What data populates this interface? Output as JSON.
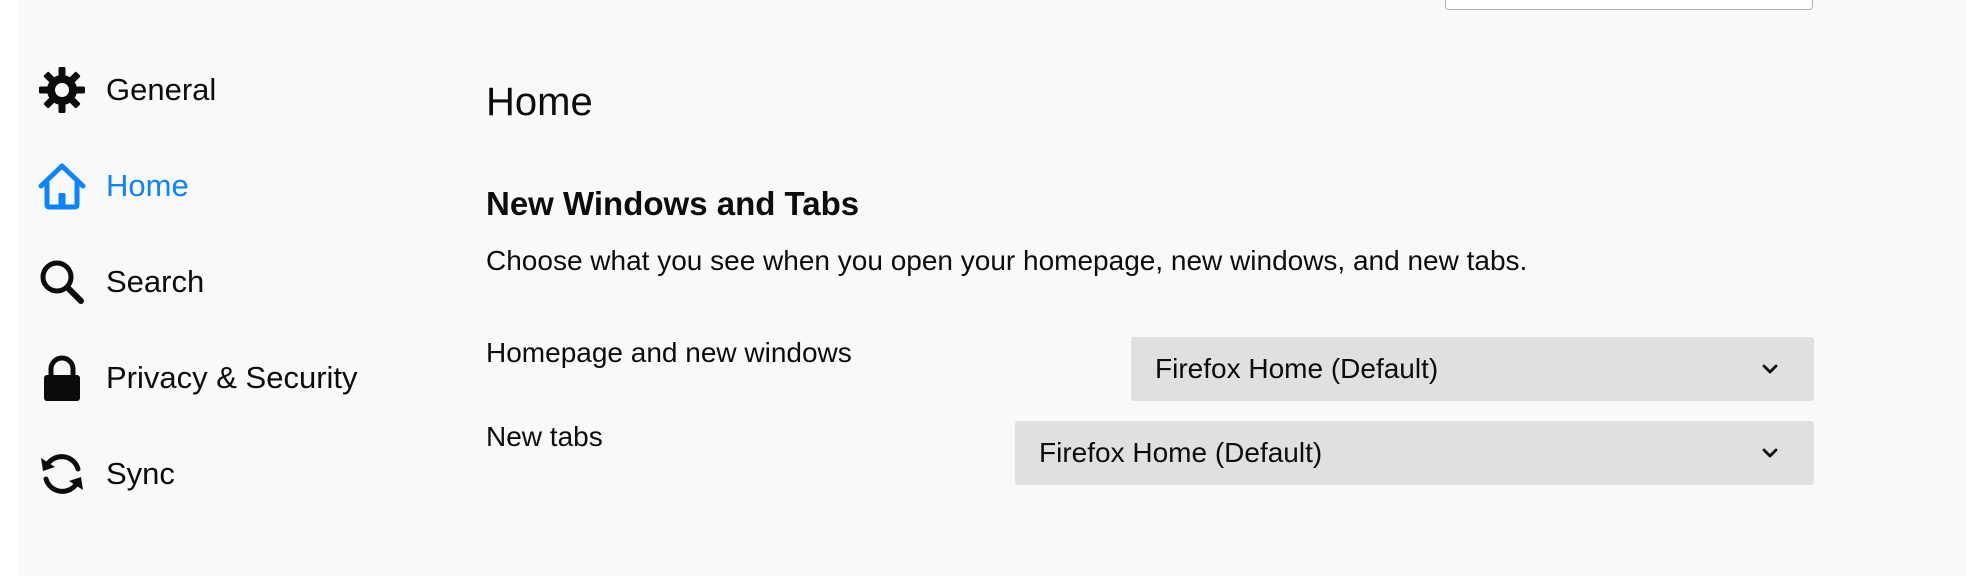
{
  "sidebar": {
    "items": [
      {
        "label": "General",
        "icon": "gear-icon",
        "selected": false
      },
      {
        "label": "Home",
        "icon": "home-icon",
        "selected": true
      },
      {
        "label": "Search",
        "icon": "search-icon",
        "selected": false
      },
      {
        "label": "Privacy & Security",
        "icon": "lock-icon",
        "selected": false
      },
      {
        "label": "Sync",
        "icon": "sync-icon",
        "selected": false
      }
    ]
  },
  "main": {
    "title": "Home",
    "section": {
      "title": "New Windows and Tabs",
      "description": "Choose what you see when you open your homepage, new windows, and new tabs.",
      "rows": [
        {
          "label": "Homepage and new windows",
          "value": "Firefox Home (Default)"
        },
        {
          "label": "New tabs",
          "value": "Firefox Home (Default)"
        }
      ]
    }
  },
  "colors": {
    "accent": "#0a84ff",
    "background": "#f9f9fa",
    "dropdown_bg": "#e0e0e1",
    "text": "#0c0c0d"
  }
}
